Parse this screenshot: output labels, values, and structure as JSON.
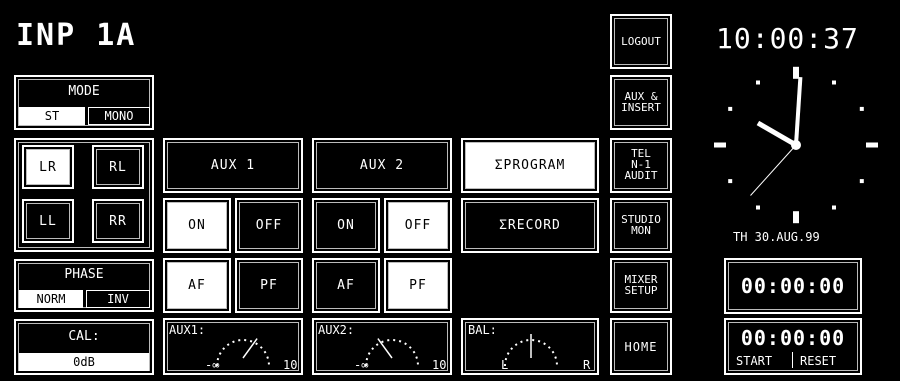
{
  "header": {
    "input_name": "INP 1A"
  },
  "mode": {
    "label": "MODE",
    "options": [
      "ST",
      "MONO"
    ],
    "selected": "ST"
  },
  "routing": {
    "buttons": [
      "LR",
      "RL",
      "LL",
      "RR"
    ],
    "selected": "LR"
  },
  "phase": {
    "label": "PHASE",
    "options": [
      "NORM",
      "INV"
    ],
    "selected": "NORM"
  },
  "cal": {
    "label": "CAL:",
    "value": "0dB"
  },
  "aux1": {
    "label": "AUX 1",
    "on": "ON",
    "off": "OFF",
    "af": "AF",
    "pf": "PF",
    "state": "ON",
    "pre_post": "AF",
    "meter": {
      "label": "AUX1:",
      "min": "-∞",
      "max": "10",
      "value": 0.65
    }
  },
  "aux2": {
    "label": "AUX 2",
    "on": "ON",
    "off": "OFF",
    "af": "AF",
    "pf": "PF",
    "state": "OFF",
    "pre_post": "PF",
    "meter": {
      "label": "AUX2:",
      "min": "-∞",
      "max": "10",
      "value": 0.35
    }
  },
  "bus": {
    "program": "ΣPROGRAM",
    "record": "ΣRECORD",
    "program_active": true
  },
  "balance": {
    "label": "BAL:",
    "left": "L",
    "right": "R",
    "value": 0.5
  },
  "menu": {
    "logout": "LOGOUT",
    "aux_insert": [
      "AUX &",
      "INSERT"
    ],
    "tel": [
      "TEL",
      "N-1",
      "AUDIT"
    ],
    "studio_mon": [
      "STUDIO",
      "MON"
    ],
    "mixer_setup": [
      "MIXER",
      "SETUP"
    ],
    "home": "HOME"
  },
  "clock": {
    "time": "10:00:37",
    "date": "TH 30.AUG.99",
    "hour": 10,
    "minute": 0,
    "second": 37
  },
  "timer1": {
    "value": "00:00:00"
  },
  "timer2": {
    "value": "00:00:00",
    "start": "START",
    "reset": "RESET"
  }
}
